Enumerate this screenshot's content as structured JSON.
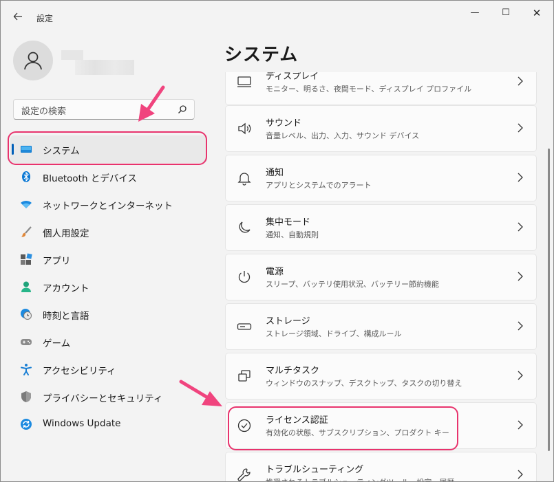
{
  "window": {
    "title": "設定",
    "controls": {
      "minimize": "—",
      "maximize": "☐",
      "close": "✕"
    }
  },
  "search": {
    "placeholder": "設定の検索"
  },
  "sidebar": {
    "items": [
      {
        "label": "システム",
        "icon": "system-icon",
        "selected": true
      },
      {
        "label": "Bluetooth とデバイス",
        "icon": "bluetooth-icon"
      },
      {
        "label": "ネットワークとインターネット",
        "icon": "wifi-icon"
      },
      {
        "label": "個人用設定",
        "icon": "brush-icon"
      },
      {
        "label": "アプリ",
        "icon": "apps-icon"
      },
      {
        "label": "アカウント",
        "icon": "account-icon"
      },
      {
        "label": "時刻と言語",
        "icon": "time-language-icon"
      },
      {
        "label": "ゲーム",
        "icon": "gamepad-icon"
      },
      {
        "label": "アクセシビリティ",
        "icon": "accessibility-icon"
      },
      {
        "label": "プライバシーとセキュリティ",
        "icon": "shield-icon"
      },
      {
        "label": "Windows Update",
        "icon": "windows-update-icon"
      }
    ]
  },
  "main": {
    "title": "システム",
    "cards": [
      {
        "title": "ディスプレイ",
        "desc": "モニター、明るさ、夜間モード、ディスプレイ プロファイル",
        "icon": "display-icon"
      },
      {
        "title": "サウンド",
        "desc": "音量レベル、出力、入力、サウンド デバイス",
        "icon": "sound-icon"
      },
      {
        "title": "通知",
        "desc": "アプリとシステムでのアラート",
        "icon": "bell-icon"
      },
      {
        "title": "集中モード",
        "desc": "通知、自動規則",
        "icon": "moon-icon"
      },
      {
        "title": "電源",
        "desc": "スリープ、バッテリ使用状況、バッテリー節約機能",
        "icon": "power-icon"
      },
      {
        "title": "ストレージ",
        "desc": "ストレージ領域、ドライブ、構成ルール",
        "icon": "storage-icon"
      },
      {
        "title": "マルチタスク",
        "desc": "ウィンドウのスナップ、デスクトップ、タスクの切り替え",
        "icon": "multitask-icon"
      },
      {
        "title": "ライセンス認証",
        "desc": "有効化の状態、サブスクリプション、プロダクト キー",
        "icon": "activation-check-icon"
      },
      {
        "title": "トラブルシューティング",
        "desc": "推奨されるトラブルシューティングツール、設定、履歴",
        "icon": "wrench-icon"
      }
    ]
  },
  "colors": {
    "accent": "#005fb8",
    "annotation": "#e8336d"
  }
}
